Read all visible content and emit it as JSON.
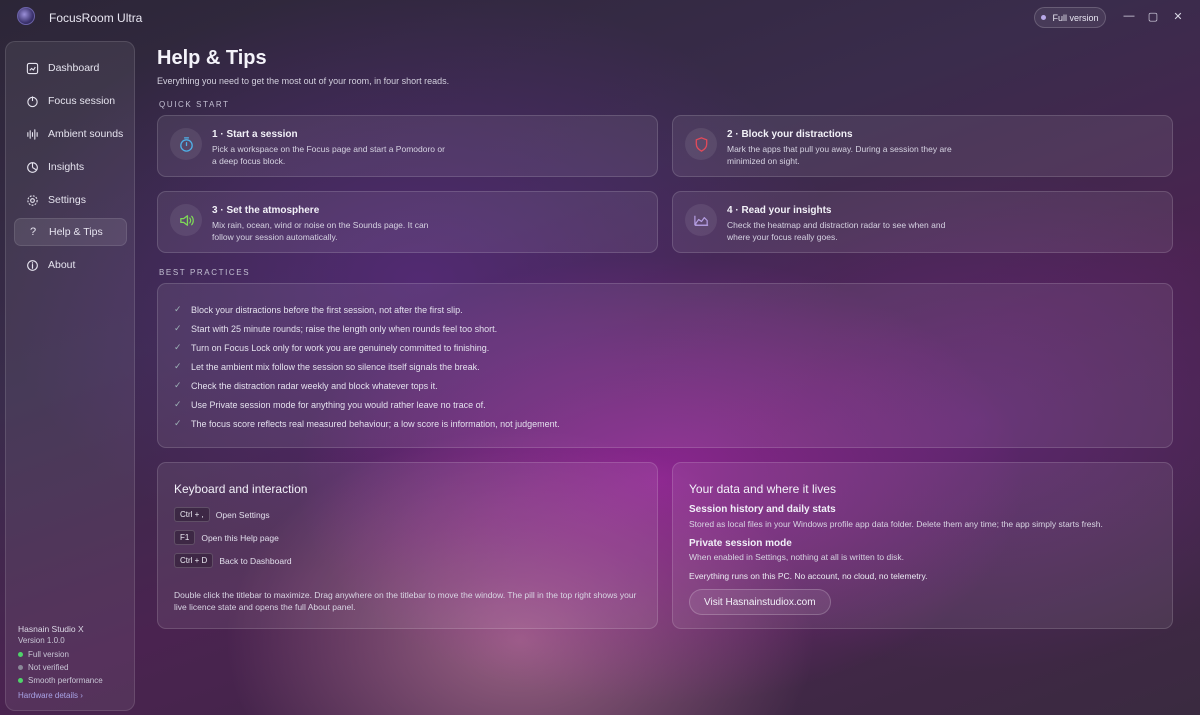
{
  "app": {
    "title": "FocusRoom Ultra",
    "license_pill": "Full version"
  },
  "window_controls": {
    "minimize": "—",
    "maximize": "▢",
    "close": "✕"
  },
  "sidebar": {
    "items": [
      {
        "label": "Dashboard",
        "icon": "dashboard-icon",
        "active": false
      },
      {
        "label": "Focus session",
        "icon": "power-icon",
        "active": false
      },
      {
        "label": "Ambient sounds",
        "icon": "waveform-icon",
        "active": false
      },
      {
        "label": "Insights",
        "icon": "insights-icon",
        "active": false
      },
      {
        "label": "Settings",
        "icon": "gear-icon",
        "active": false
      },
      {
        "label": "Help & Tips",
        "icon": "question-icon",
        "active": true
      },
      {
        "label": "About",
        "icon": "info-icon",
        "active": false
      }
    ],
    "footer": {
      "studio": "Hasnain Studio X",
      "version": "Version 1.0.0",
      "statuses": [
        {
          "label": "Full version",
          "color": "#4fd36a"
        },
        {
          "label": "Not verified",
          "color": "#8a8898"
        },
        {
          "label": "Smooth performance",
          "color": "#4fd36a"
        }
      ],
      "hardware_link": "Hardware details ›"
    }
  },
  "main": {
    "title": "Help & Tips",
    "subtitle": "Everything you need to get the most out of your room, in four short reads.",
    "quick_start_label": "QUICK START",
    "quick_start": [
      {
        "title": "1 · Start a session",
        "desc": "Pick a workspace on the Focus page and start a Pomodoro or a deep focus block.",
        "icon": "timer-icon",
        "color": "#4fb0e8"
      },
      {
        "title": "2 · Block your distractions",
        "desc": "Mark the apps that pull you away. During a session they are minimized on sight.",
        "icon": "shield-icon",
        "color": "#e04a5a"
      },
      {
        "title": "3 · Set the atmosphere",
        "desc": "Mix rain, ocean, wind or noise on the Sounds page. It can follow your session automatically.",
        "icon": "speaker-icon",
        "color": "#7ed957"
      },
      {
        "title": "4 · Read your insights",
        "desc": "Check the heatmap and distraction radar to see when and where your focus really goes.",
        "icon": "chart-area-icon",
        "color": "#b39ce0"
      }
    ],
    "best_practices_label": "BEST PRACTICES",
    "best_practices": [
      "Block your distractions before the first session, not after the first slip.",
      "Start with 25 minute rounds; raise the length only when rounds feel too short.",
      "Turn on Focus Lock only for work you are genuinely committed to finishing.",
      "Let the ambient mix follow the session so silence itself signals the break.",
      "Check the distraction radar weekly and block whatever tops it.",
      "Use Private session mode for anything you would rather leave no trace of.",
      "The focus score reflects real measured behaviour; a low score is information, not judgement."
    ],
    "keyboard": {
      "title": "Keyboard and interaction",
      "shortcuts": [
        {
          "keys": "Ctrl + ,",
          "action": "Open Settings"
        },
        {
          "keys": "F1",
          "action": "Open this Help page"
        },
        {
          "keys": "Ctrl + D",
          "action": "Back to Dashboard"
        }
      ],
      "note": "Double click the titlebar to maximize. Drag anywhere on the titlebar to move the window. The pill in the top right shows your live licence state and opens the full About panel."
    },
    "data": {
      "title": "Your data and where it lives",
      "history_title": "Session history and daily stats",
      "history_desc": "Stored as local files in your Windows profile app data folder. Delete them any time; the app simply starts fresh.",
      "private_title": "Private session mode",
      "private_desc": "When enabled in Settings, nothing at all is written to disk.",
      "local_note": "Everything runs on this PC. No account, no cloud, no telemetry.",
      "visit_button": "Visit Hasnainstudiox.com"
    }
  }
}
